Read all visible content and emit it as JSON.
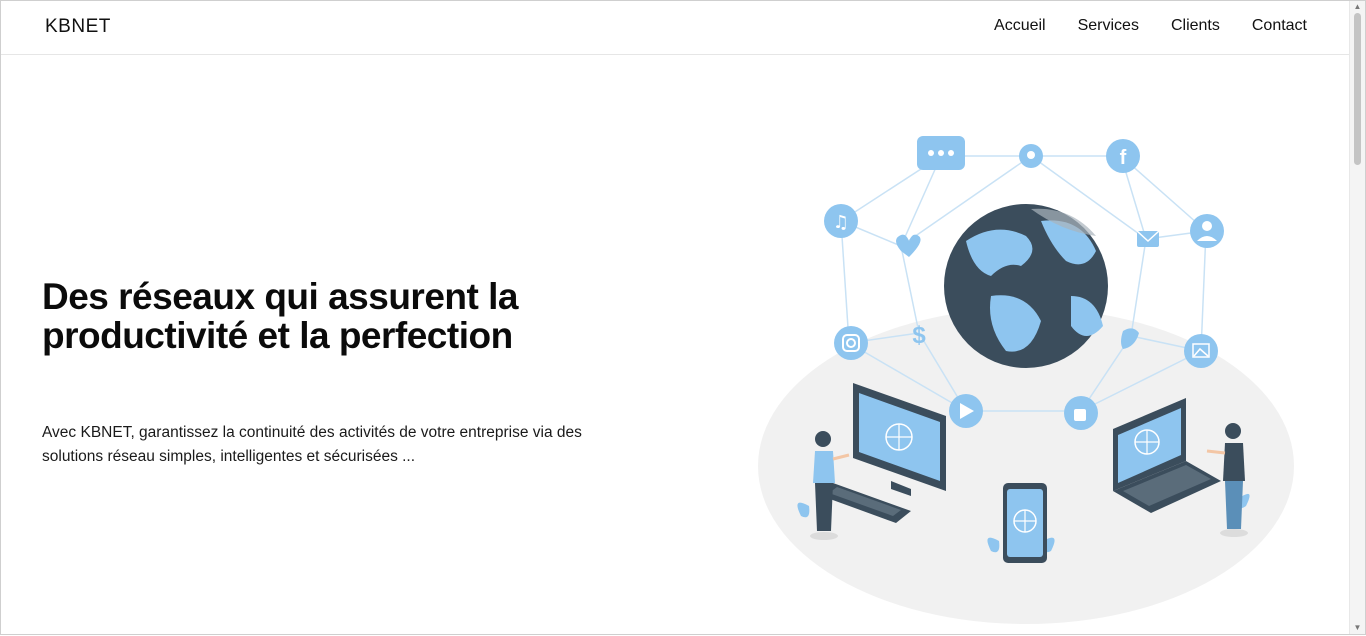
{
  "brand": "KBNET",
  "nav": {
    "items": [
      {
        "label": "Accueil"
      },
      {
        "label": "Services"
      },
      {
        "label": "Clients"
      },
      {
        "label": "Contact"
      }
    ]
  },
  "hero": {
    "title": "Des réseaux qui assurent la productivité et la perfection",
    "description": "Avec KBNET, garantissez la continuité des activités de votre entreprise via des solutions réseau simples, intelligentes et sécurisées ..."
  },
  "colors": {
    "accent_blue": "#8ec5ef",
    "dark_slate": "#3b4d5c",
    "light_gray": "#f1f1f1"
  }
}
